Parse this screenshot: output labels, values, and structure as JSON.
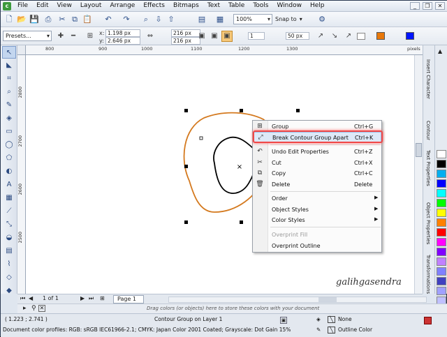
{
  "menu": [
    "File",
    "Edit",
    "View",
    "Layout",
    "Arrange",
    "Effects",
    "Bitmaps",
    "Text",
    "Table",
    "Tools",
    "Window",
    "Help"
  ],
  "toolbar": {
    "zoom": "100%",
    "snap": "Snap to"
  },
  "property_bar": {
    "presets": "Presets...",
    "x_label": "x:",
    "x_value": "1.198 px",
    "y_label": "y:",
    "y_value": "2.646 px",
    "w_value": "216 px",
    "h_value": "216 px",
    "steps": "1",
    "offset": "50 px"
  },
  "ruler": {
    "units": "pixels",
    "h_ticks": [
      "800",
      "900",
      "1000",
      "1100",
      "1200",
      "1300"
    ],
    "v_ticks": [
      "2800",
      "2700",
      "2600",
      "2500"
    ]
  },
  "context_menu": {
    "items": [
      {
        "label": "Group",
        "shortcut": "Ctrl+G",
        "icon": "group-icon"
      },
      {
        "label": "Break Contour Group Apart",
        "shortcut": "Ctrl+K",
        "icon": "break-apart-icon"
      },
      {
        "label": "Undo Edit Properties",
        "shortcut": "Ctrl+Z",
        "icon": "undo-icon"
      },
      {
        "label": "Cut",
        "shortcut": "Ctrl+X",
        "icon": "scissors-icon"
      },
      {
        "label": "Copy",
        "shortcut": "Ctrl+C",
        "icon": "copy-icon"
      },
      {
        "label": "Delete",
        "shortcut": "Delete",
        "icon": "trash-icon"
      },
      {
        "label": "Order"
      },
      {
        "label": "Object Styles"
      },
      {
        "label": "Color Styles"
      },
      {
        "label": "Overprint Fill"
      },
      {
        "label": "Overprint Outline"
      }
    ]
  },
  "dockers": [
    "Insert Character",
    "Contour",
    "Text Properties",
    "Object Properties",
    "Transformations"
  ],
  "palette": [
    "#ffffff",
    "#000000",
    "#00aeef",
    "#0000ff",
    "#00ffff",
    "#00ff00",
    "#ffff00",
    "#ff8000",
    "#ff0000",
    "#ff00ff",
    "#8000ff",
    "#c080ff",
    "#8080ff",
    "#4040c0",
    "#a0a0ff",
    "#c0c0ff",
    "#d0d0e0",
    "#e0d0ff"
  ],
  "page_nav": {
    "page_count": "1 of 1",
    "page_tab": "Page 1"
  },
  "drag_hint": "Drag colors (or objects) here to store these colors with your document",
  "status": {
    "coords": "( 1.223 ; 2.741 )",
    "object_info": "Contour Group on Layer 1",
    "profiles": "Document color profiles: RGB: sRGB IEC61966-2.1; CMYK: Japan Color 2001 Coated; Grayscale: Dot Gain 15%",
    "fill": "None",
    "outline": "Outline Color"
  },
  "watermark": "galihgasendra",
  "colors": {
    "contour": "#d4791e",
    "highlight": "#f04848"
  }
}
